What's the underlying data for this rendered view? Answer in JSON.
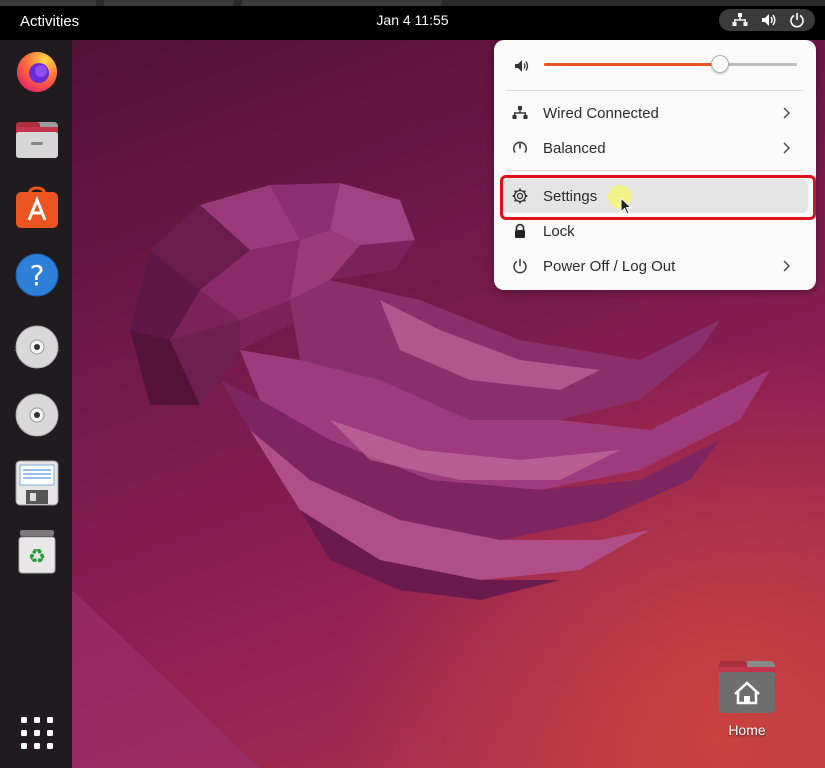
{
  "topbar": {
    "activities_label": "Activities",
    "clock": "Jan 4  11:55"
  },
  "dock": {
    "items": [
      {
        "name": "Firefox"
      },
      {
        "name": "Files"
      },
      {
        "name": "Ubuntu Software"
      },
      {
        "name": "Help"
      },
      {
        "name": "Disc drive 1"
      },
      {
        "name": "Disc drive 2"
      },
      {
        "name": "Floppy / Text Editor"
      },
      {
        "name": "Trash"
      },
      {
        "name": "Show Applications"
      }
    ]
  },
  "desktop": {
    "home_label": "Home"
  },
  "system_menu": {
    "volume_level": 0.69,
    "items": [
      {
        "label": "Wired Connected",
        "icon": "network-wired-icon",
        "has_submenu": true
      },
      {
        "label": "Balanced",
        "icon": "power-profile-icon",
        "has_submenu": true
      },
      {
        "label": "Settings",
        "icon": "settings-gear-icon",
        "has_submenu": false,
        "highlighted": true
      },
      {
        "label": "Lock",
        "icon": "lock-icon",
        "has_submenu": false
      },
      {
        "label": "Power Off / Log Out",
        "icon": "power-icon",
        "has_submenu": true
      }
    ]
  },
  "colors": {
    "accent": "#e95420",
    "highlight_border": "#e0101a",
    "topbar": "#000000",
    "dock": "#1f1b1e"
  }
}
